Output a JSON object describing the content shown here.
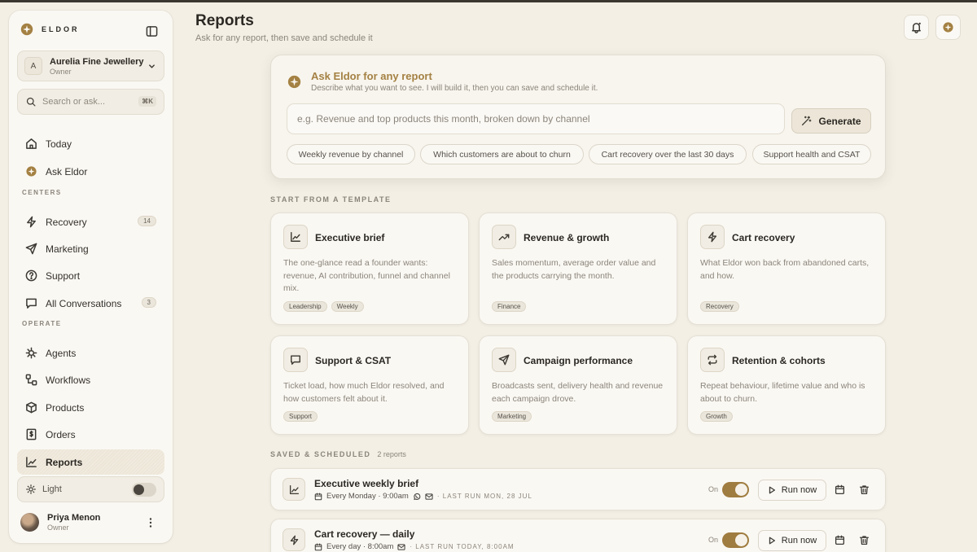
{
  "sidebar": {
    "brand": "ELDOR",
    "workspace": {
      "initial": "A",
      "name": "Aurelia Fine Jewellery",
      "role": "Owner"
    },
    "search": {
      "placeholder": "Search or ask...",
      "shortcut": "⌘K"
    },
    "items_top": [
      {
        "label": "Today",
        "icon": "home-icon"
      },
      {
        "label": "Ask Eldor",
        "icon": "eldor-logo-icon"
      }
    ],
    "section_centers": "CENTERS",
    "items_centers": [
      {
        "label": "Recovery",
        "icon": "bolt-icon",
        "count": "14"
      },
      {
        "label": "Marketing",
        "icon": "send-icon"
      },
      {
        "label": "Support",
        "icon": "help-circle-icon"
      },
      {
        "label": "All Conversations",
        "icon": "message-square-icon",
        "count": "3"
      }
    ],
    "section_operate": "OPERATE",
    "items_operate": [
      {
        "label": "Agents",
        "icon": "agent-icon"
      },
      {
        "label": "Workflows",
        "icon": "workflow-icon"
      },
      {
        "label": "Products",
        "icon": "package-icon"
      },
      {
        "label": "Orders",
        "icon": "receipt-icon"
      },
      {
        "label": "Reports",
        "icon": "line-chart-icon",
        "active": true
      }
    ],
    "theme": {
      "label": "Light",
      "enabled": false
    },
    "user": {
      "name": "Priya Menon",
      "role": "Owner"
    }
  },
  "header": {
    "title": "Reports",
    "subtitle": "Ask for any report, then save and schedule it"
  },
  "ask": {
    "title": "Ask Eldor for any report",
    "description": "Describe what you want to see. I will build it, then you can save and schedule it.",
    "input_placeholder": "e.g. Revenue and top products this month, broken down by channel",
    "input_value": "",
    "generate_label": "Generate",
    "suggestions": [
      "Weekly revenue by channel",
      "Which customers are about to churn",
      "Cart recovery over the last 30 days",
      "Support health and CSAT"
    ]
  },
  "templates": {
    "heading": "START FROM A TEMPLATE",
    "items": [
      {
        "title": "Executive brief",
        "icon": "line-chart-icon",
        "description": "The one-glance read a founder wants: revenue, AI contribution, funnel and channel mix.",
        "tags": [
          "Leadership",
          "Weekly"
        ]
      },
      {
        "title": "Revenue & growth",
        "icon": "trending-up-icon",
        "description": "Sales momentum, average order value and the products carrying the month.",
        "tags": [
          "Finance"
        ]
      },
      {
        "title": "Cart recovery",
        "icon": "bolt-icon",
        "description": "What Eldor won back from abandoned carts, and how.",
        "tags": [
          "Recovery"
        ]
      },
      {
        "title": "Support & CSAT",
        "icon": "message-square-icon",
        "description": "Ticket load, how much Eldor resolved, and how customers felt about it.",
        "tags": [
          "Support"
        ]
      },
      {
        "title": "Campaign performance",
        "icon": "send-icon",
        "description": "Broadcasts sent, delivery health and revenue each campaign drove.",
        "tags": [
          "Marketing"
        ]
      },
      {
        "title": "Retention & cohorts",
        "icon": "repeat-icon",
        "description": "Repeat behaviour, lifetime value and who is about to churn.",
        "tags": [
          "Growth"
        ]
      }
    ]
  },
  "saved": {
    "heading": "SAVED & SCHEDULED",
    "count": "2 reports",
    "items": [
      {
        "title": "Executive weekly brief",
        "icon": "line-chart-icon",
        "schedule": "Every Monday · 9:00am",
        "channels": [
          "whatsapp-icon",
          "mail-icon"
        ],
        "last_run": "· LAST RUN MON, 28 JUL",
        "status": "On",
        "enabled": true,
        "run_label": "Run now"
      },
      {
        "title": "Cart recovery — daily",
        "icon": "bolt-icon",
        "schedule": "Every day · 8:00am",
        "channels": [
          "mail-icon"
        ],
        "last_run": "· LAST RUN TODAY, 8:00AM",
        "status": "On",
        "enabled": true,
        "run_label": "Run now"
      }
    ]
  },
  "colors": {
    "accent": "#9f7c3f",
    "accent_text": "#a48143",
    "background": "#f3efe5",
    "card": "#faf8f3"
  }
}
